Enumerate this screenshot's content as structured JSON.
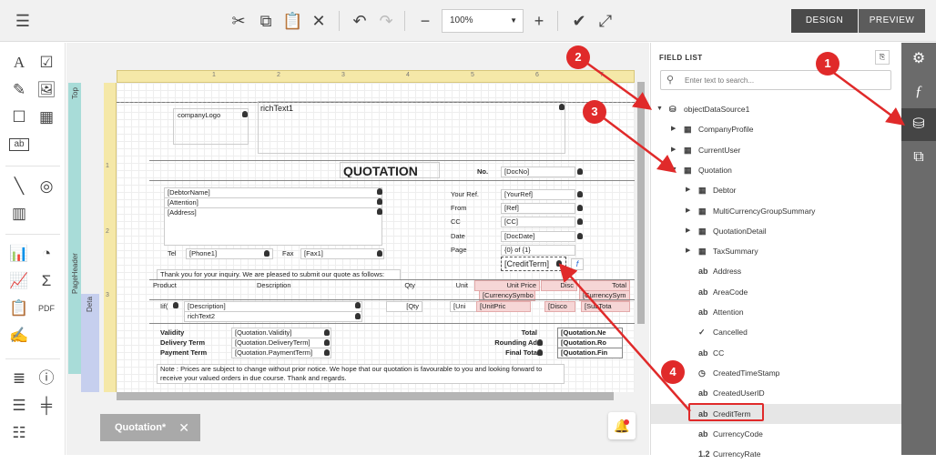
{
  "toolbar": {
    "zoom": "100%",
    "design": "DESIGN",
    "preview": "PREVIEW"
  },
  "document_tab": {
    "label": "Quotation*",
    "close": "✕"
  },
  "bands": {
    "top": "Top",
    "page_header": "PageHeader",
    "detail": "Deta"
  },
  "ruler": {
    "h": [
      "1",
      "2",
      "3",
      "4",
      "5",
      "6",
      "7"
    ],
    "v": [
      "1",
      "2",
      "3"
    ]
  },
  "report": {
    "logo": "companyLogo",
    "richtext1": "richText1",
    "title": "QUOTATION",
    "debtor": [
      "[DebtorName]",
      "[Attention]",
      "[Address]"
    ],
    "tel_label": "Tel",
    "phone": "[Phone1]",
    "fax_label": "Fax",
    "fax": "[Fax1]",
    "no_label": "No.",
    "docno": "[DocNo]",
    "info_labels": [
      "Your Ref.",
      "From",
      "CC",
      "Date",
      "Page"
    ],
    "info_values": [
      "[YourRef]",
      "[Ref]",
      "[CC]",
      "[DocDate]",
      "{0} of {1}"
    ],
    "credit_term": "[CreditTerm]",
    "func_glyph": "f",
    "thanks": "Thank you for your inquiry. We are pleased to submit our quote as follows:",
    "col_headers": [
      "Product",
      "Description",
      "Qty",
      "Unit",
      "Unit Price",
      "Disc",
      "Total"
    ],
    "currency1": "[CurrencySymbo",
    "currency2": "[CurrencySym",
    "detail_cells": [
      "Iif(",
      "[Description]",
      "[Qty",
      "[Uni",
      "[UnitPric",
      "[Disco",
      "[SubTota"
    ],
    "richtext2": "richText2",
    "footer_labels": [
      "Validity",
      "Delivery Term",
      "Payment Term"
    ],
    "footer_values": [
      "[Quotation.Validity]",
      "[Quotation.DeliveryTerm]",
      "[Quotation.PaymentTerm]"
    ],
    "total_labels": [
      "Total",
      "Rounding Ad",
      "Final Tota"
    ],
    "total_values": [
      "[Quotation.Ne",
      "[Quotation.Ro",
      "[Quotation.Fin"
    ],
    "note": "Note : Prices are subject to change without prior notice. We hope that our quotation is favourable to you and looking forward to receive your valued orders in due course. Thank and regards."
  },
  "field_list": {
    "title": "FIELD LIST",
    "search_placeholder": "Enter text to search...",
    "items": [
      {
        "label": "objectDataSource1",
        "icon": "database-icon"
      },
      {
        "label": "CompanyProfile",
        "icon": "table-icon"
      },
      {
        "label": "CurrentUser",
        "icon": "table-icon"
      },
      {
        "label": "Quotation",
        "icon": "table-icon"
      },
      {
        "label": "Debtor",
        "icon": "table-icon"
      },
      {
        "label": "MultiCurrencyGroupSummary",
        "icon": "table-icon"
      },
      {
        "label": "QuotationDetail",
        "icon": "table-icon"
      },
      {
        "label": "TaxSummary",
        "icon": "table-icon"
      },
      {
        "label": "Address",
        "icon": "ab"
      },
      {
        "label": "AreaCode",
        "icon": "ab"
      },
      {
        "label": "Attention",
        "icon": "ab"
      },
      {
        "label": "Cancelled",
        "icon": "✓"
      },
      {
        "label": "CC",
        "icon": "ab"
      },
      {
        "label": "CreatedTimeStamp",
        "icon": "clock"
      },
      {
        "label": "CreatedUserID",
        "icon": "ab"
      },
      {
        "label": "CreditTerm",
        "icon": "ab"
      },
      {
        "label": "CurrencyCode",
        "icon": "ab"
      },
      {
        "label": "CurrencyRate",
        "icon": "1.2"
      }
    ]
  },
  "annotations": [
    "1",
    "2",
    "3",
    "4"
  ],
  "colors": {
    "accent_red": "#e02a2a",
    "nav": "#6b6b6b",
    "band": "#a8dcd8",
    "ruler": "#f5e8a8"
  }
}
